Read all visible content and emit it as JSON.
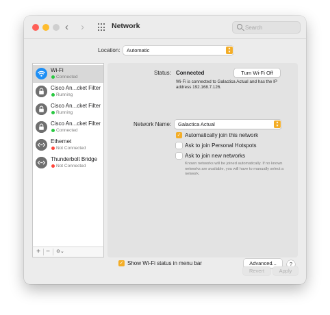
{
  "window": {
    "title": "Network"
  },
  "toolbar": {
    "back_glyph": "‹",
    "forward_glyph": "›",
    "search_placeholder": "Search"
  },
  "location": {
    "label": "Location:",
    "value": "Automatic"
  },
  "services": [
    {
      "name": "Wi-Fi",
      "status": "Connected",
      "status_color": "#28c840",
      "icon": "wifi-icon",
      "selected": true
    },
    {
      "name": "Cisco An...cket Filter",
      "status": "Running",
      "status_color": "#28c840",
      "icon": "lock-icon"
    },
    {
      "name": "Cisco An...cket Filter",
      "status": "Running",
      "status_color": "#28c840",
      "icon": "lock-icon"
    },
    {
      "name": "Cisco An...cket Filter",
      "status": "Connected",
      "status_color": "#28c840",
      "icon": "lock-icon"
    },
    {
      "name": "Ethernet",
      "status": "Not Connected",
      "status_color": "#ff453a",
      "icon": "ethernet-icon"
    },
    {
      "name": "Thunderbolt Bridge",
      "status": "Not Connected",
      "status_color": "#ff453a",
      "icon": "thunderbolt-bridge-icon"
    }
  ],
  "sidebar_actions": {
    "add": "+",
    "remove": "−",
    "action": "⊖⌄"
  },
  "detail": {
    "status_label": "Status:",
    "status_value": "Connected",
    "turn_off_button": "Turn Wi-Fi Off",
    "status_description": "Wi-Fi is connected to Galactica Actual and has the IP address 192.168.7.126.",
    "network_name_label": "Network Name:",
    "network_name_value": "Galactica Actual",
    "auto_join": {
      "label": "Automatically join this network",
      "checked": true
    },
    "personal_hotspots": {
      "label": "Ask to join Personal Hotspots",
      "checked": false
    },
    "new_networks": {
      "label": "Ask to join new networks",
      "checked": false
    },
    "note": "Known networks will be joined automatically. If no known networks are available, you will have to manually select a network.",
    "show_status": {
      "label": "Show Wi-Fi status in menu bar",
      "checked": true
    },
    "advanced_button": "Advanced...",
    "help_button": "?"
  },
  "footer": {
    "revert": "Revert",
    "apply": "Apply"
  },
  "colors": {
    "accent": "#f3ad27",
    "connected": "#28c840",
    "disconnected": "#ff453a"
  }
}
